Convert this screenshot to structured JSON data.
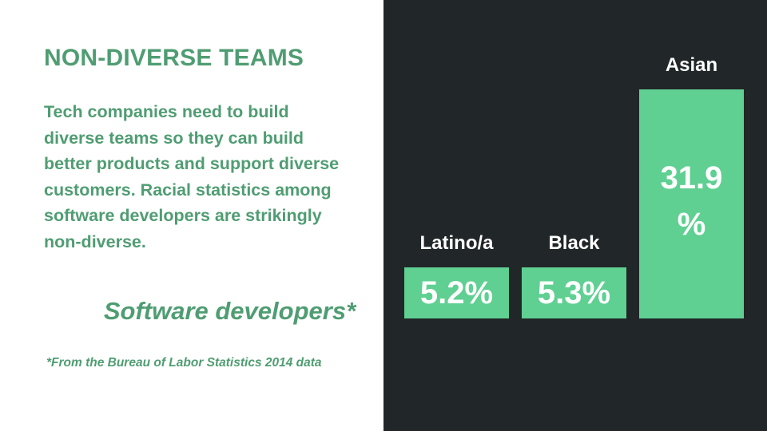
{
  "slide": {
    "title": "NON-DIVERSE TEAMS",
    "body": "Tech companies need to build diverse teams so they can build better products and support diverse customers. Racial statistics among software developers are strikingly non-diverse.",
    "source_note": "*From the Bureau of Labor Statistics 2014 data"
  },
  "colors": {
    "accent_green": "#4f9d72",
    "bar_green": "#5fd092",
    "panel_dark": "#212628",
    "label_white": "#ffffff"
  },
  "chart_data": {
    "type": "bar",
    "title": "Software developers*",
    "categories": [
      "Latino/a",
      "Black",
      "Asian"
    ],
    "values": [
      5.2,
      5.3,
      31.9
    ],
    "value_labels": [
      "5.2%",
      "5.3%",
      "31.9\n%"
    ],
    "unit": "%",
    "xlabel": "",
    "ylabel": "",
    "grid": false
  }
}
